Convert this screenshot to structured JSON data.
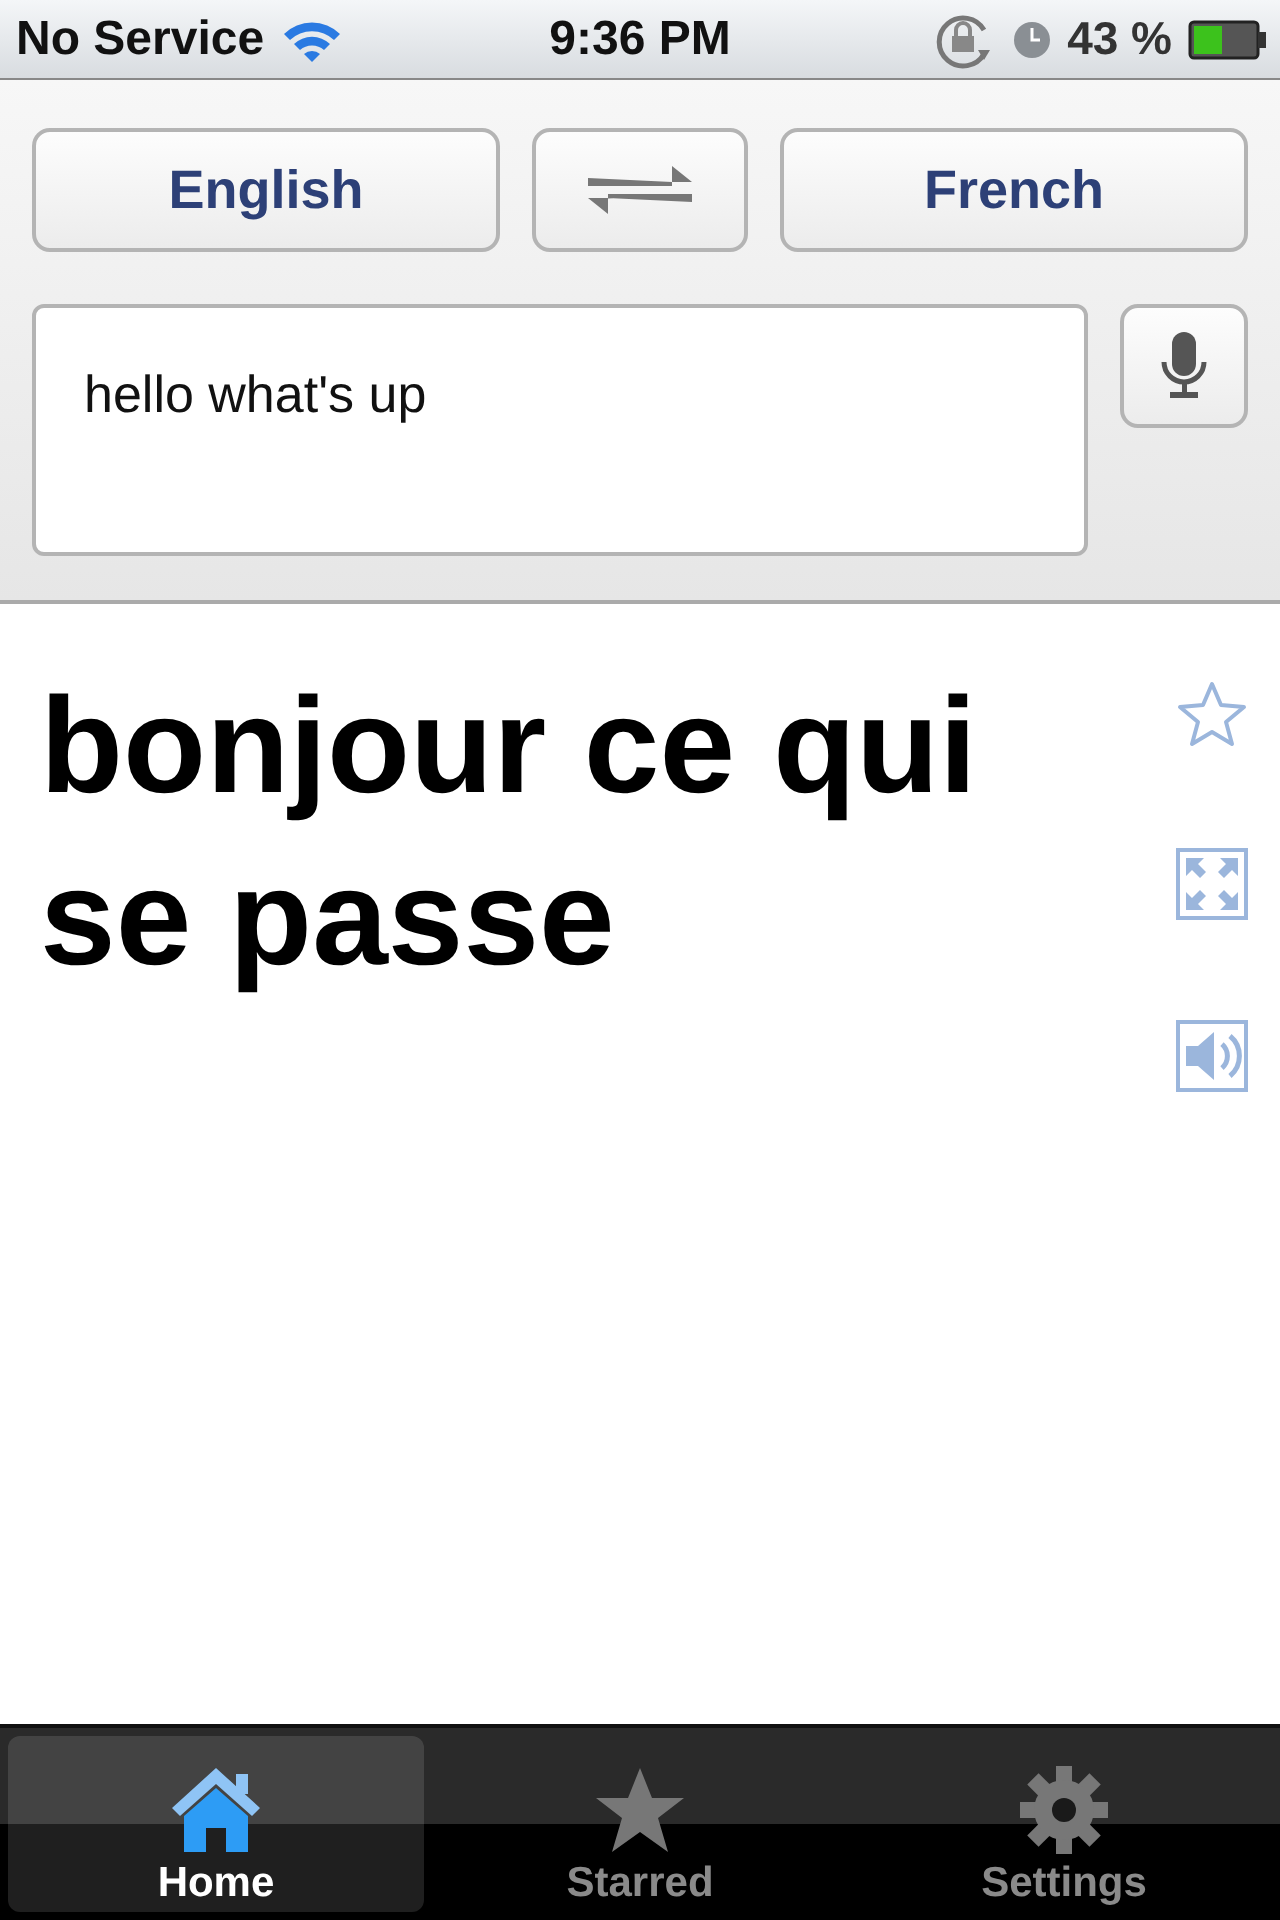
{
  "status_bar": {
    "carrier": "No Service",
    "time": "9:36 PM",
    "battery": "43 %"
  },
  "languages": {
    "source": "English",
    "target": "French"
  },
  "input": {
    "value": "hello what's up"
  },
  "translation": "bonjour ce qui se passe",
  "tabs": [
    {
      "label": "Home",
      "kind": "home",
      "selected": true
    },
    {
      "label": "Starred",
      "kind": "star",
      "selected": false
    },
    {
      "label": "Settings",
      "kind": "gear",
      "selected": false
    }
  ]
}
